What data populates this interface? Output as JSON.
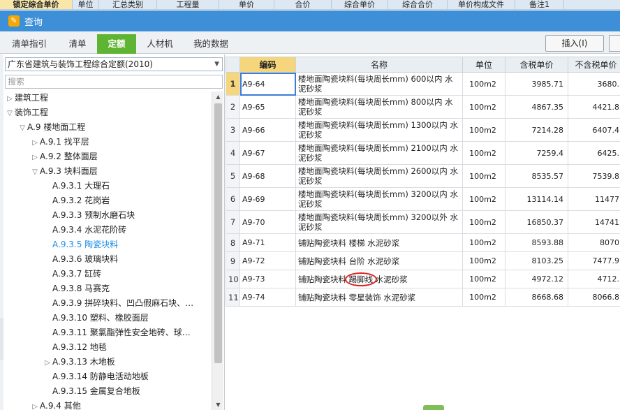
{
  "background_header": {
    "columns": [
      {
        "label": "锁定综合单价",
        "locked": true
      },
      {
        "label": "单位"
      },
      {
        "label": "汇总类别"
      },
      {
        "label": "工程量"
      },
      {
        "label": "单价"
      },
      {
        "label": "合价"
      },
      {
        "label": "综合单价"
      },
      {
        "label": "综合合价"
      },
      {
        "label": "单价构成文件"
      },
      {
        "label": "备注1"
      }
    ]
  },
  "window": {
    "title": "查询",
    "icon": "app-logo-icon"
  },
  "tabs": [
    {
      "label": "清单指引"
    },
    {
      "label": "清单"
    },
    {
      "label": "定额",
      "active": true
    },
    {
      "label": "人材机"
    },
    {
      "label": "我的数据"
    }
  ],
  "toolbar": {
    "insert_label": "插入(I)"
  },
  "left_panel": {
    "library": "广东省建筑与装饰工程综合定额(2010)",
    "search_placeholder": "搜索",
    "tree": [
      {
        "label": "建筑工程",
        "arrow": "▷"
      },
      {
        "label": "装饰工程",
        "arrow": "▽"
      },
      {
        "label": "A.9 楼地面工程",
        "arrow": "▽"
      },
      {
        "label": "A.9.1 找平层",
        "arrow": "▷"
      },
      {
        "label": "A.9.2 整体面层",
        "arrow": "▷"
      },
      {
        "label": "A.9.3 块料面层",
        "arrow": "▽"
      },
      {
        "label": "A.9.3.1 大理石",
        "arrow": ""
      },
      {
        "label": "A.9.3.2 花岗岩",
        "arrow": ""
      },
      {
        "label": "A.9.3.3 预制水磨石块",
        "arrow": ""
      },
      {
        "label": "A.9.3.4 水泥花阶砖",
        "arrow": ""
      },
      {
        "label": "A.9.3.5 陶瓷块料",
        "arrow": "",
        "selected": true
      },
      {
        "label": "A.9.3.6 玻璃块料",
        "arrow": ""
      },
      {
        "label": "A.9.3.7 缸砖",
        "arrow": ""
      },
      {
        "label": "A.9.3.8 马赛克",
        "arrow": ""
      },
      {
        "label": "A.9.3.9 拼碎块料、凹凸假麻石块、…",
        "arrow": ""
      },
      {
        "label": "A.9.3.10 塑料、橡胶面层",
        "arrow": ""
      },
      {
        "label": "A.9.3.11 聚氯酯弹性安全地砖、球…",
        "arrow": ""
      },
      {
        "label": "A.9.3.12 地毯",
        "arrow": ""
      },
      {
        "label": "A.9.3.13 木地板",
        "arrow": "▷"
      },
      {
        "label": "A.9.3.14 防静电活动地板",
        "arrow": ""
      },
      {
        "label": "A.9.3.15 金属复合地板",
        "arrow": ""
      },
      {
        "label": "A.9.4 其他",
        "arrow": "▷"
      }
    ]
  },
  "grid": {
    "headers": {
      "code": "编码",
      "name": "名称",
      "unit": "单位",
      "tax_price": "含税单价",
      "notax_price": "不含税单价"
    },
    "rows": [
      {
        "no": "1",
        "code": "A9-64",
        "name": "楼地面陶瓷块料(每块周长mm) 600以内 水泥砂浆",
        "unit": "100m2",
        "tax": "3985.71",
        "notax": "3680.",
        "selected": true
      },
      {
        "no": "2",
        "code": "A9-65",
        "name": "楼地面陶瓷块料(每块周长mm) 800以内 水泥砂浆",
        "unit": "100m2",
        "tax": "4867.35",
        "notax": "4421.8"
      },
      {
        "no": "3",
        "code": "A9-66",
        "name": "楼地面陶瓷块料(每块周长mm) 1300以内 水泥砂浆",
        "unit": "100m2",
        "tax": "7214.28",
        "notax": "6407.4"
      },
      {
        "no": "4",
        "code": "A9-67",
        "name": "楼地面陶瓷块料(每块周长mm) 2100以内 水泥砂浆",
        "unit": "100m2",
        "tax": "7259.4",
        "notax": "6425."
      },
      {
        "no": "5",
        "code": "A9-68",
        "name": "楼地面陶瓷块料(每块周长mm) 2600以内 水泥砂浆",
        "unit": "100m2",
        "tax": "8535.57",
        "notax": "7539.8"
      },
      {
        "no": "6",
        "code": "A9-69",
        "name": "楼地面陶瓷块料(每块周长mm) 3200以内 水泥砂浆",
        "unit": "100m2",
        "tax": "13114.14",
        "notax": "11477"
      },
      {
        "no": "7",
        "code": "A9-70",
        "name": "楼地面陶瓷块料(每块周长mm) 3200以外 水泥砂浆",
        "unit": "100m2",
        "tax": "16850.37",
        "notax": "14741"
      },
      {
        "no": "8",
        "code": "A9-71",
        "name": "铺贴陶瓷块料 楼梯 水泥砂浆",
        "unit": "100m2",
        "tax": "8593.88",
        "notax": "8070"
      },
      {
        "no": "9",
        "code": "A9-72",
        "name": "铺贴陶瓷块料 台阶 水泥砂浆",
        "unit": "100m2",
        "tax": "8103.25",
        "notax": "7477.9"
      },
      {
        "no": "10",
        "code": "A9-73",
        "name_parts": [
          "铺贴陶瓷块料 ",
          "踢脚线",
          " 水泥砂浆"
        ],
        "name": "铺贴陶瓷块料 踢脚线 水泥砂浆",
        "unit": "100m2",
        "tax": "4972.12",
        "notax": "4712.",
        "highlight": "踢脚线"
      },
      {
        "no": "11",
        "code": "A9-74",
        "name": "铺贴陶瓷块料 零星装饰 水泥砂浆",
        "unit": "100m2",
        "tax": "8668.68",
        "notax": "8066.8"
      }
    ]
  }
}
